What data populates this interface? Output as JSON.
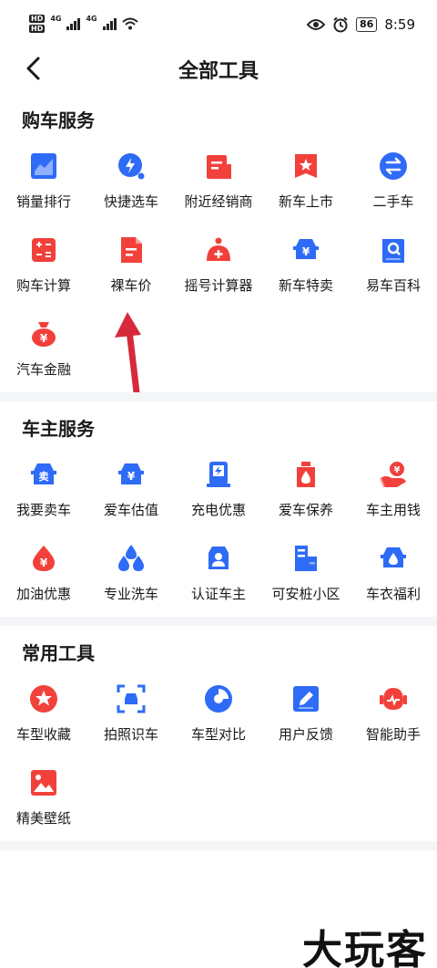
{
  "status": {
    "hd1": "HD",
    "hd2": "HD",
    "net1": "4G",
    "net2": "4G",
    "battery": "86",
    "time": "8:59"
  },
  "nav": {
    "title": "全部工具"
  },
  "colors": {
    "blue": "#2e6bf6",
    "red": "#f2413b"
  },
  "sections": [
    {
      "title": "购车服务",
      "tools": [
        {
          "label": "销量排行",
          "icon": "chart-icon",
          "color": "blue"
        },
        {
          "label": "快捷选车",
          "icon": "bolt-search-icon",
          "color": "blue"
        },
        {
          "label": "附近经销商",
          "icon": "store-icon",
          "color": "red"
        },
        {
          "label": "新车上市",
          "icon": "star-flag-icon",
          "color": "red"
        },
        {
          "label": "二手车",
          "icon": "swap-icon",
          "color": "blue"
        },
        {
          "label": "购车计算",
          "icon": "calculator-icon",
          "color": "red"
        },
        {
          "label": "裸车价",
          "icon": "document-icon",
          "color": "red"
        },
        {
          "label": "摇号计算器",
          "icon": "lottery-icon",
          "color": "red"
        },
        {
          "label": "新车特卖",
          "icon": "car-yuan-icon",
          "color": "blue"
        },
        {
          "label": "易车百科",
          "icon": "book-search-icon",
          "color": "blue"
        },
        {
          "label": "汽车金融",
          "icon": "money-bag-icon",
          "color": "red"
        }
      ]
    },
    {
      "title": "车主服务",
      "tools": [
        {
          "label": "我要卖车",
          "icon": "sell-car-icon",
          "color": "blue",
          "badge": "卖"
        },
        {
          "label": "爱车估值",
          "icon": "car-value-icon",
          "color": "blue"
        },
        {
          "label": "充电优惠",
          "icon": "charger-icon",
          "color": "blue"
        },
        {
          "label": "爱车保养",
          "icon": "oil-can-icon",
          "color": "red"
        },
        {
          "label": "车主用钱",
          "icon": "hand-coin-icon",
          "color": "red"
        },
        {
          "label": "加油优惠",
          "icon": "fuel-drop-icon",
          "color": "red"
        },
        {
          "label": "专业洗车",
          "icon": "water-drops-icon",
          "color": "blue"
        },
        {
          "label": "认证车主",
          "icon": "verified-owner-icon",
          "color": "blue"
        },
        {
          "label": "可安桩小区",
          "icon": "community-icon",
          "color": "blue"
        },
        {
          "label": "车衣福利",
          "icon": "car-cover-icon",
          "color": "blue"
        }
      ]
    },
    {
      "title": "常用工具",
      "tools": [
        {
          "label": "车型收藏",
          "icon": "favorite-icon",
          "color": "red"
        },
        {
          "label": "拍照识车",
          "icon": "scan-car-icon",
          "color": "blue"
        },
        {
          "label": "车型对比",
          "icon": "pie-compare-icon",
          "color": "blue"
        },
        {
          "label": "用户反馈",
          "icon": "feedback-edit-icon",
          "color": "blue"
        },
        {
          "label": "智能助手",
          "icon": "robot-icon",
          "color": "red"
        },
        {
          "label": "精美壁纸",
          "icon": "wallpaper-icon",
          "color": "red"
        }
      ]
    }
  ],
  "watermark": "大玩客"
}
